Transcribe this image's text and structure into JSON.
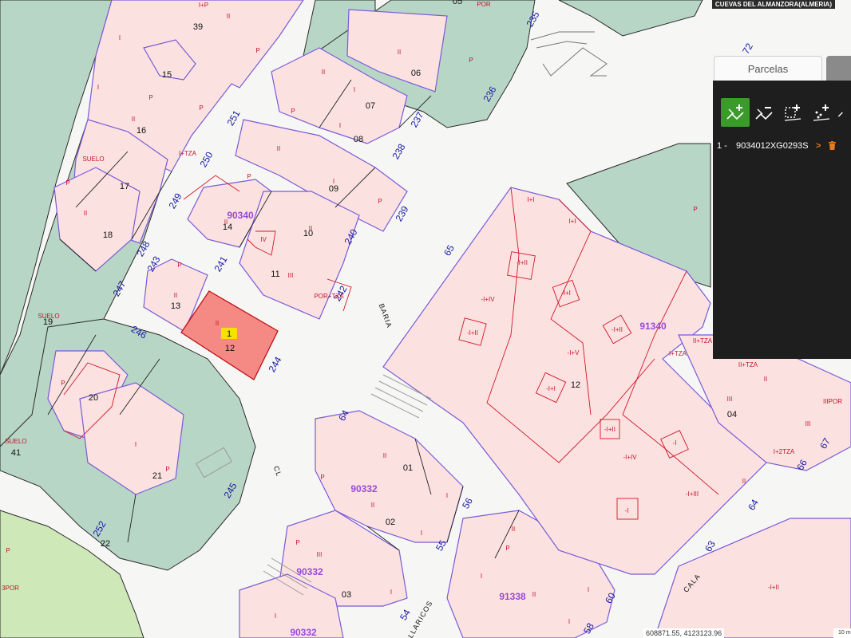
{
  "location_title": "CUEVAS DEL ALMANZORA(ALMERIA)",
  "panel": {
    "tab_label": "Parcelas",
    "tools": [
      {
        "icon": "add-parcel-icon",
        "active": true
      },
      {
        "icon": "remove-parcel-icon",
        "active": false
      },
      {
        "icon": "add-selection-icon",
        "active": false
      },
      {
        "icon": "add-point-icon",
        "active": false
      },
      {
        "icon": "more-icon",
        "active": false
      }
    ],
    "results": [
      {
        "index": "1 -",
        "reference": "9034012XG0293S",
        "arrow": ">",
        "delete_icon": "trash-icon"
      }
    ]
  },
  "selected_parcel": {
    "badge": "1",
    "number": "12",
    "floors": "II",
    "color": "#f58a84"
  },
  "map_labels": {
    "parcel_numbers": [
      "39",
      "15",
      "16",
      "17",
      "18",
      "19",
      "20",
      "21",
      "41",
      "22",
      "05",
      "06",
      "07",
      "08",
      "09",
      "10",
      "11",
      "13",
      "14",
      "01",
      "02",
      "03",
      "04",
      "12"
    ],
    "street_numbers": [
      "235",
      "236",
      "237",
      "238",
      "239",
      "240",
      "242",
      "241",
      "243",
      "244",
      "245",
      "246",
      "247",
      "248",
      "249",
      "250",
      "251",
      "252",
      "64",
      "65",
      "54",
      "55",
      "56",
      "58",
      "60",
      "63",
      "64",
      "66",
      "67",
      "72"
    ],
    "block_ids": [
      "90340",
      "91340",
      "90332",
      "90332",
      "91338",
      "90332"
    ],
    "street_names": [
      "BARIA",
      "CL",
      "CALA",
      "LLARICOS"
    ],
    "land_use": [
      "SUELO",
      "SUELO",
      "SUELO",
      "POR+TZA",
      "POR",
      "I+TZA",
      "II+TZA",
      "II+TZA",
      "I+TZA",
      "I+2TZA",
      "IIIPOR",
      "3POR",
      "I+P"
    ],
    "floor_marks": [
      "-I+II",
      "-I+IV",
      "-I+I",
      "-I+V",
      "-I+II",
      "-I+III",
      "-I+I",
      "-I+IV",
      "-I",
      "-I",
      "-I+II",
      "-I+II",
      "I+I",
      "I+I"
    ]
  },
  "coordinates": "608871.55, 4123123.96",
  "scale": "10 m",
  "colors": {
    "parcel_green": "#b8d6c6",
    "parcel_pink": "#fbe2e0",
    "panel": "#1e1e1e",
    "accent": "#3a9a2a",
    "selected": "#f58a84"
  }
}
